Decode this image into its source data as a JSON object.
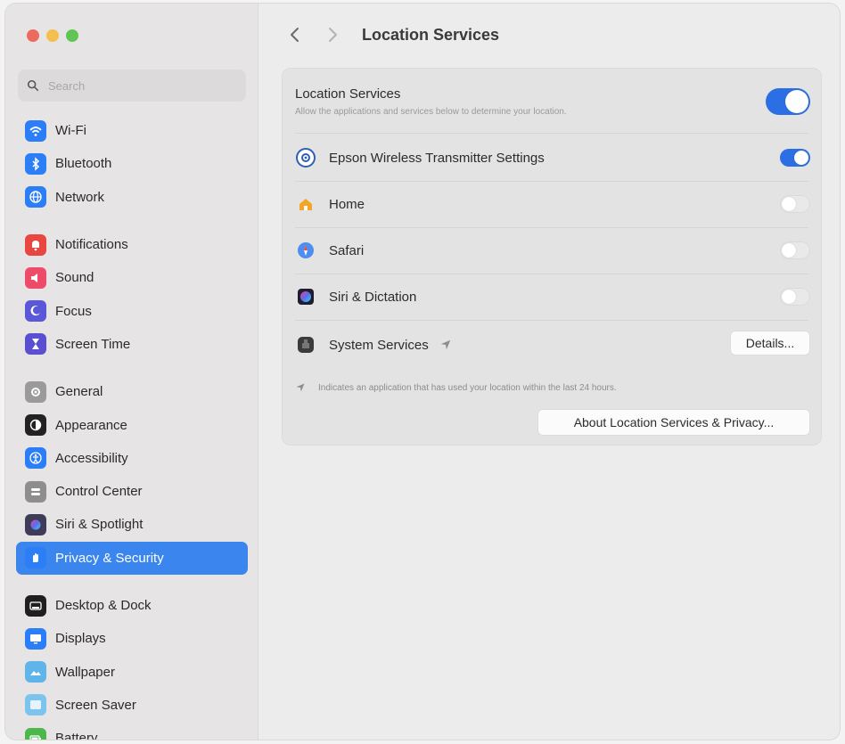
{
  "sidebar": {
    "search_placeholder": "Search",
    "groups": [
      [
        {
          "label": "Wi-Fi",
          "icon": "wifi-icon",
          "color": "#2c7ef6"
        },
        {
          "label": "Bluetooth",
          "icon": "bluetooth-icon",
          "color": "#2c7ef6"
        },
        {
          "label": "Network",
          "icon": "globe-icon",
          "color": "#2c7ef6"
        }
      ],
      [
        {
          "label": "Notifications",
          "icon": "bell-icon",
          "color": "#e8473f"
        },
        {
          "label": "Sound",
          "icon": "speaker-icon",
          "color": "#ee4a6a"
        },
        {
          "label": "Focus",
          "icon": "moon-icon",
          "color": "#5a58d8"
        },
        {
          "label": "Screen Time",
          "icon": "hourglass-icon",
          "color": "#5a4fd0"
        }
      ],
      [
        {
          "label": "General",
          "icon": "gear-icon",
          "color": "#9a9a9a"
        },
        {
          "label": "Appearance",
          "icon": "appearance-icon",
          "color": "#222222"
        },
        {
          "label": "Accessibility",
          "icon": "accessibility-icon",
          "color": "#2c7ef6"
        },
        {
          "label": "Control Center",
          "icon": "control-center-icon",
          "color": "#8e8e8e"
        },
        {
          "label": "Siri & Spotlight",
          "icon": "siri-icon",
          "color": "#3d3d5a"
        },
        {
          "label": "Privacy & Security",
          "icon": "hand-icon",
          "color": "#2c7ef6",
          "active": true
        }
      ],
      [
        {
          "label": "Desktop & Dock",
          "icon": "dock-icon",
          "color": "#1f1f1f"
        },
        {
          "label": "Displays",
          "icon": "display-icon",
          "color": "#2c7ef6"
        },
        {
          "label": "Wallpaper",
          "icon": "wallpaper-icon",
          "color": "#5fb4ea"
        },
        {
          "label": "Screen Saver",
          "icon": "screensaver-icon",
          "color": "#7cc4ee"
        },
        {
          "label": "Battery",
          "icon": "battery-icon",
          "color": "#4cb84c"
        }
      ]
    ]
  },
  "header": {
    "title": "Location Services"
  },
  "location": {
    "label": "Location Services",
    "description": "Allow the applications and services below to determine your location.",
    "enabled": true
  },
  "apps": [
    {
      "label": "Epson Wireless Transmitter Settings",
      "icon": "epson-icon",
      "enabled": true
    },
    {
      "label": "Home",
      "icon": "home-icon",
      "enabled": false
    },
    {
      "label": "Safari",
      "icon": "safari-icon",
      "enabled": false
    },
    {
      "label": "Siri & Dictation",
      "icon": "siri-icon",
      "enabled": false
    }
  ],
  "system_services": {
    "label": "System Services",
    "button_label": "Details..."
  },
  "note": {
    "text": "Indicates an application that has used your location within the last 24 hours."
  },
  "about_button_label": "About Location Services & Privacy...",
  "colors": {
    "accent": "#2c6fe4",
    "sidebar_active": "#3a86ee"
  }
}
